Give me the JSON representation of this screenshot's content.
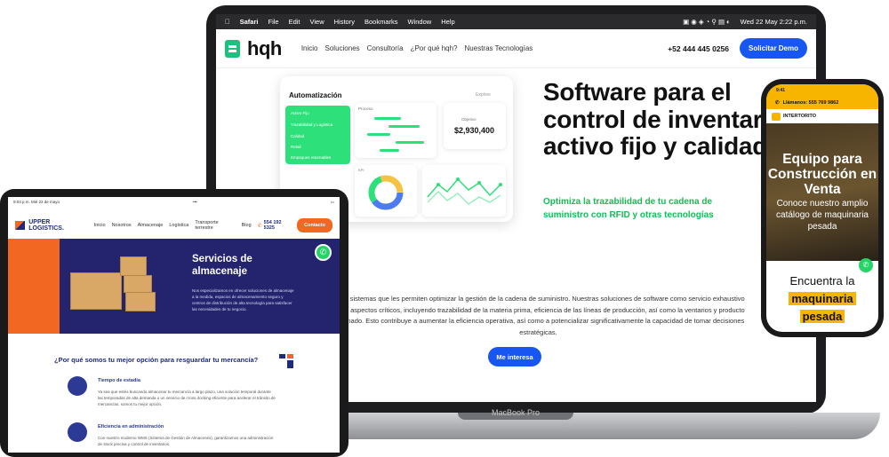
{
  "macbook": {
    "label": "MacBook Pro",
    "menubar": {
      "items": [
        "Safari",
        "File",
        "Edit",
        "View",
        "History",
        "Bookmarks",
        "Window",
        "Help"
      ],
      "clock": "Wed 22 May  2:22 p.m."
    },
    "site": {
      "logo": "hqh",
      "nav": [
        "Inicio",
        "Soluciones",
        "Consultoría",
        "¿Por qué hqh?",
        "Nuestras Tecnologías"
      ],
      "phone": "+52 444 445 0256",
      "cta": "Solicitar Demo",
      "dashboard": {
        "title": "Automatización",
        "search": "Explore",
        "menu": [
          "Activo Fijo",
          "Trazabilidad y Logística",
          "Calidad",
          "Retail",
          "Empaques retornables"
        ],
        "panel_proceso": "Proceso",
        "objective_label": "Objetivo",
        "objective_value": "$2,930,400",
        "kpi_label": "KPI"
      },
      "hero_title": "Software para el control de inventario, activo fijo y calidad",
      "hero_subtitle": "Optimiza la trazabilidad de tu cadena de suministro con RFID y otras tecnologías",
      "paragraph": "resas sistemas que les permiten optimizar la gestión de la cadena de suministro. Nuestras soluciones de software como servicio exhaustivo sobre aspectos críticos, incluyendo trazabilidad de la materia prima, eficiencia de las líneas de producción, así como la ventarios y producto terminado. Esto contribuye a aumentar la eficiencia operativa, así como a potencializar significativamente la capacidad de tomar decisiones estratégicas.",
      "interest_button": "Me interesa"
    }
  },
  "ipad": {
    "status_left": "9:03 p.m.   Mié 22 de mayo",
    "status_center": "•••",
    "site": {
      "logo": "UPPER LOGISTICS.",
      "nav": [
        "Inicio",
        "Nosotros",
        "Almacenaje",
        "Logística",
        "Transporte terrestre",
        "Blog"
      ],
      "phone": "554 192 5325",
      "contact": "Contacto",
      "banner_title": "Servicios de almacenaje",
      "banner_text": "Nos especializamos en ofrecer soluciones de almacenaje a la medida, espacios de almacenamiento seguro y centros de distribución de alta tecnología para satisfacer las necesidades de tu negocio.",
      "why_title": "¿Por qué somos tu mejor opción para resguardar tu mercancía?",
      "features": [
        {
          "title": "Tiempo de estadía",
          "text": "Ya sea que estés buscando almacenar tu mercancía a largo plazo, una solución temporal durante las temporadas de alta demanda o un servicio de cross docking eficiente para acelerar el tránsito de mercancías, somos tu mejor opción."
        },
        {
          "title": "Eficiencia en administración",
          "text": "Con nuestro moderno WMS (Sistema de Gestión de Almacenes), garantizamos una administración de stock precisa y control de inventarios."
        }
      ]
    }
  },
  "iphone": {
    "time": "9:41",
    "call": "Llámanos: 555 769 9862",
    "brand": "INTERTORITO",
    "hero_title": "Equipo para Construcción en Venta",
    "hero_desc": "Conoce nuestro amplio catálogo de maquinaria pesada",
    "find_line1": "Encuentra la",
    "find_line2": "maquinaria",
    "find_line3": "pesada"
  }
}
